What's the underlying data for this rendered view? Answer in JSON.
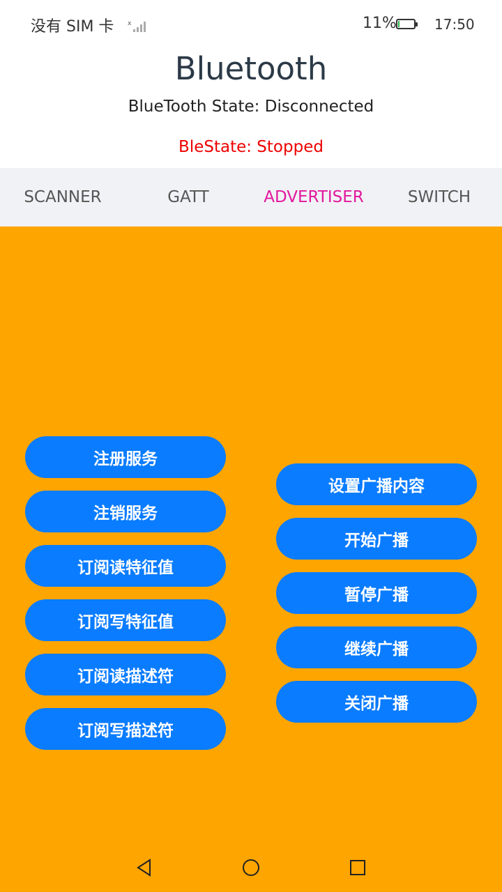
{
  "status_bar": {
    "carrier": "没有 SIM 卡",
    "battery_percent": "11%",
    "battery_level": 0.11,
    "time": "17:50"
  },
  "header": {
    "title": "Bluetooth",
    "bluetooth_state": "BlueTooth State: Disconnected",
    "ble_state": "BleState: Stopped",
    "ble_state_color": "#ee0000"
  },
  "tabs": [
    {
      "label": "SCANNER",
      "active": false
    },
    {
      "label": "GATT",
      "active": false
    },
    {
      "label": "ADVERTISER",
      "active": true
    },
    {
      "label": "SWITCH",
      "active": false
    }
  ],
  "left_buttons": [
    "注册服务",
    "注销服务",
    "订阅读特征值",
    "订阅写特征值",
    "订阅读描述符",
    "订阅写描述符"
  ],
  "right_buttons": [
    "设置广播内容",
    "开始广播",
    "暂停广播",
    "继续广播",
    "关闭广播"
  ],
  "colors": {
    "background": "#ffa500",
    "button": "#0a7cff",
    "tab_active": "#e2189e",
    "tab_bar": "#f1f2f5"
  },
  "nav_bar": {
    "back_icon": "back-triangle-icon",
    "home_icon": "home-circle-icon",
    "recents_icon": "recents-square-icon"
  }
}
